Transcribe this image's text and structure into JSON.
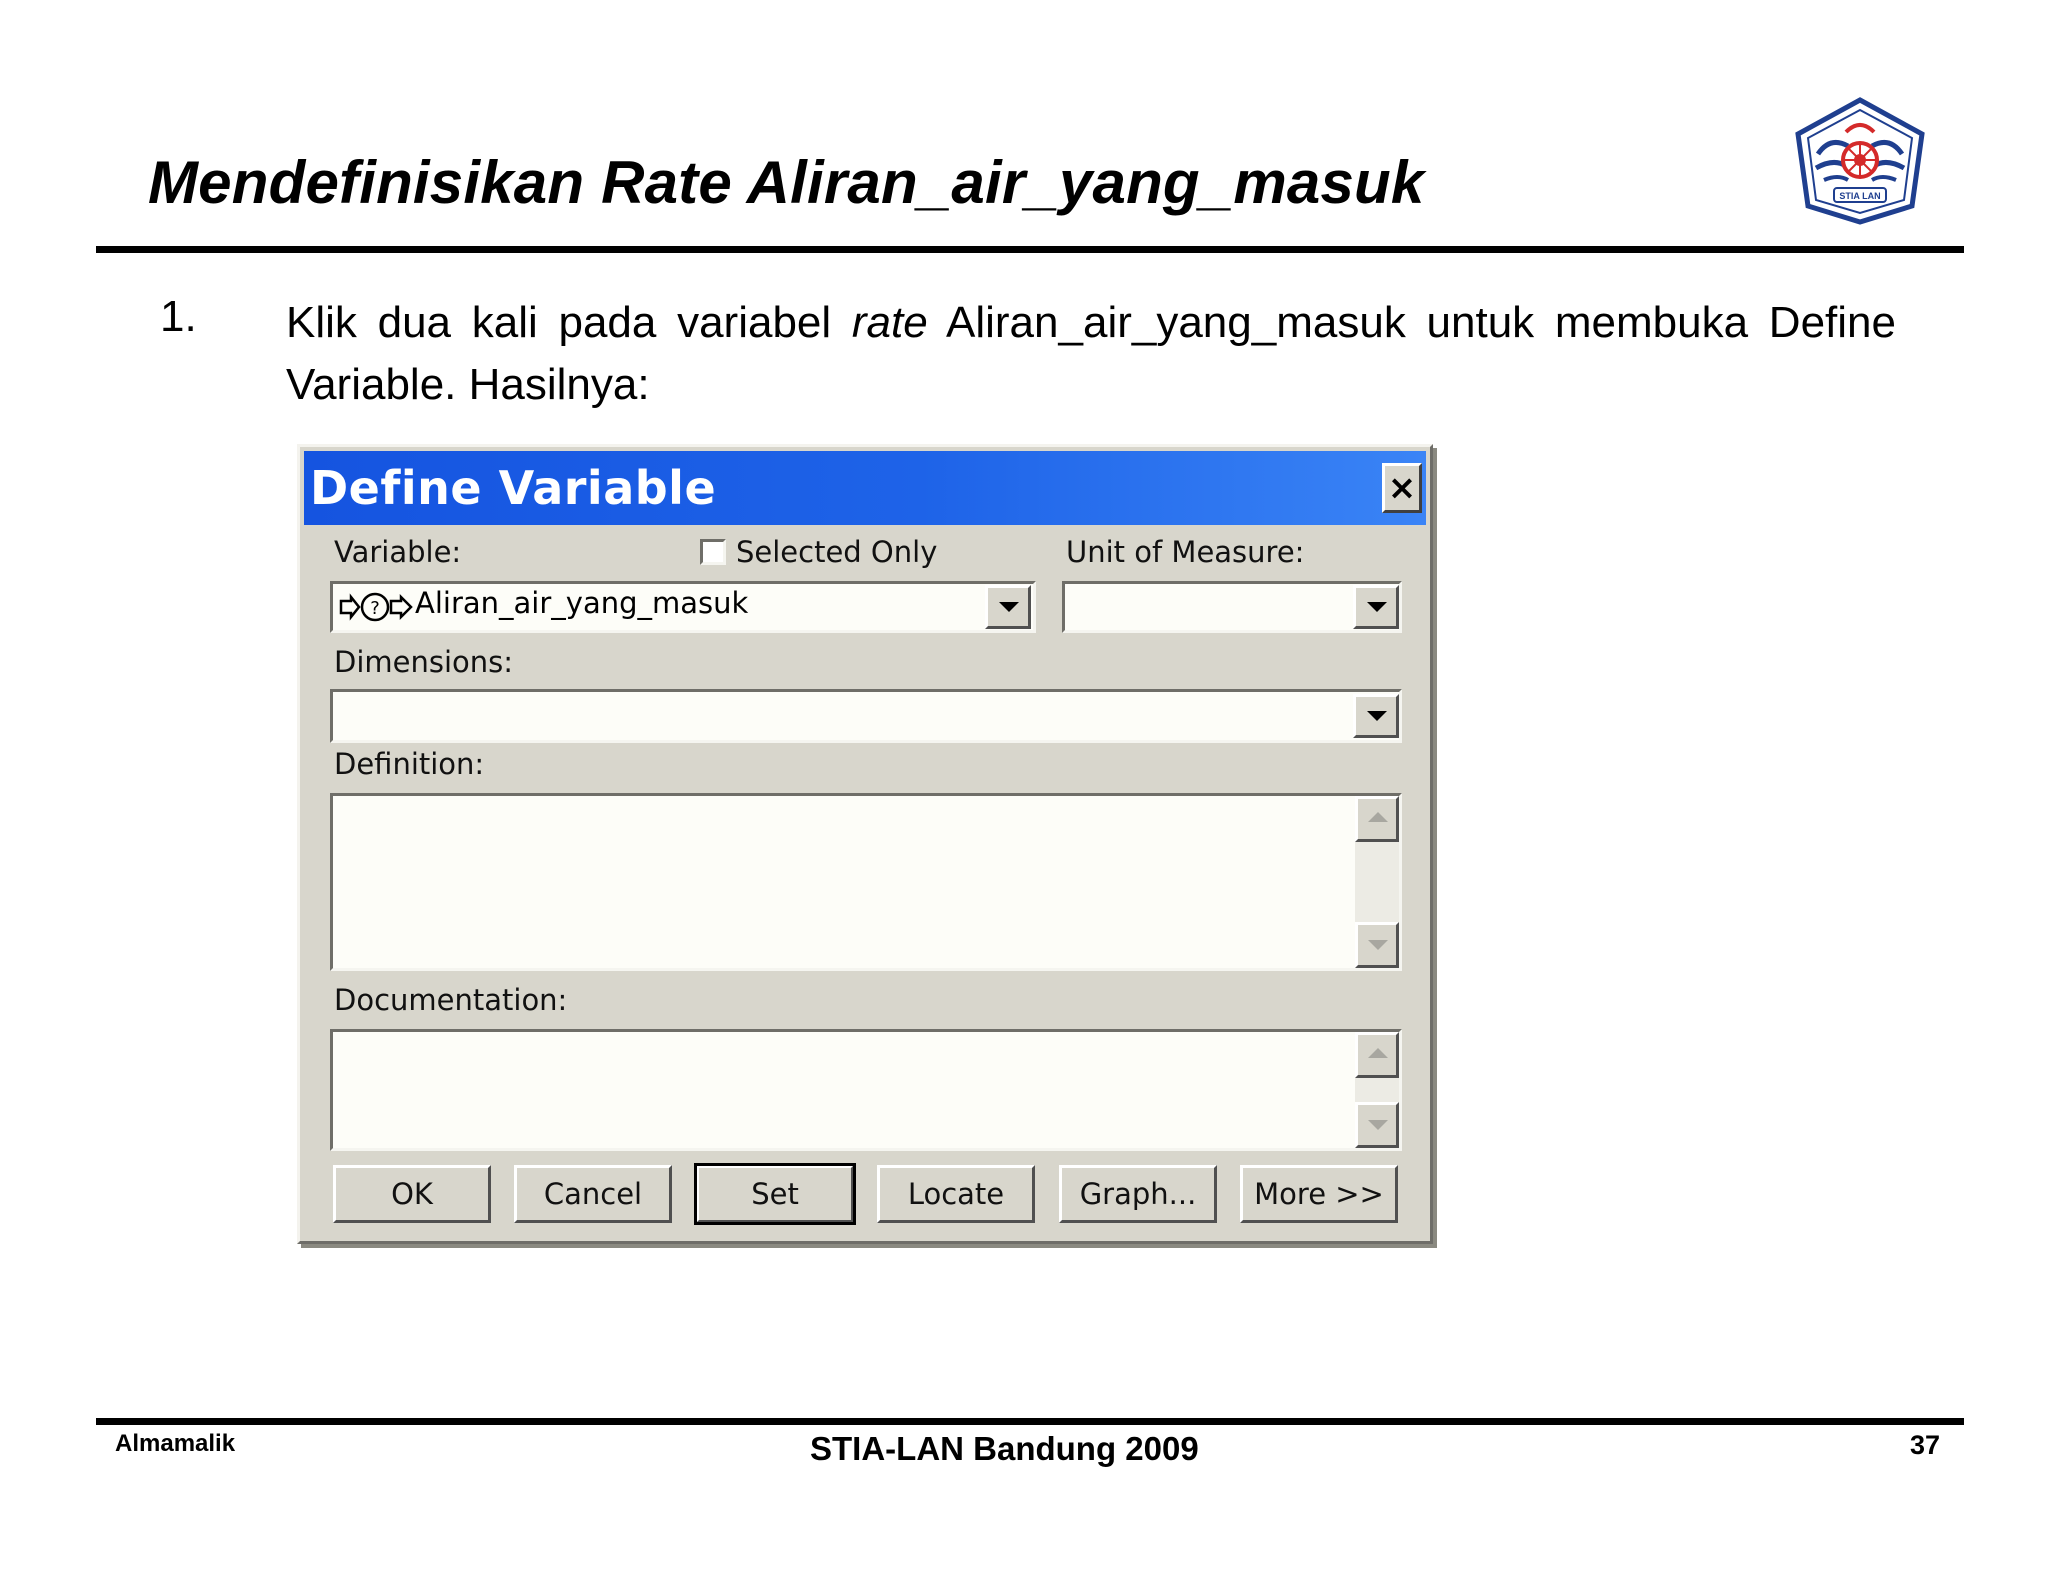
{
  "slide": {
    "title": "Mendefinisikan Rate Aliran_air_yang_masuk",
    "logo_text": "STIA LAN",
    "step": {
      "number": "1.",
      "text_before": "Klik dua kali pada variabel ",
      "text_italic": "rate",
      "text_after": " Aliran_air_yang_masuk untuk membuka Define Variable. Hasilnya:"
    },
    "footer": {
      "author": "Almamalik",
      "center": "STIA-LAN Bandung 2009",
      "page": "37"
    }
  },
  "dialog": {
    "title": "Define Variable",
    "close_symbol": "×",
    "variable_label": "Variable:",
    "variable_value": "Aliran_air_yang_masuk",
    "selected_only_label": "Selected Only",
    "selected_only_checked": false,
    "unit_label": "Unit of Measure:",
    "unit_value": "",
    "dimensions_label": "Dimensions:",
    "dimensions_value": "",
    "definition_label": "Definition:",
    "definition_value": "",
    "documentation_label": "Documentation:",
    "documentation_value": "",
    "buttons": {
      "ok": "OK",
      "cancel": "Cancel",
      "set": "Set",
      "locate": "Locate",
      "graph": "Graph...",
      "more": "More >>"
    }
  },
  "colors": {
    "titlebar_start": "#1554e0",
    "titlebar_end": "#3a84f6",
    "dialog_face": "#d8d6cc",
    "logo_blue": "#1f3f8f",
    "logo_red": "#d42a2a"
  },
  "icons": {
    "logo": "emblem-logo",
    "variable_type": "rate-variable-icon",
    "close": "close-icon",
    "dropdown": "chevron-down-icon",
    "scroll_up": "scroll-up-icon",
    "scroll_down": "scroll-down-icon"
  }
}
